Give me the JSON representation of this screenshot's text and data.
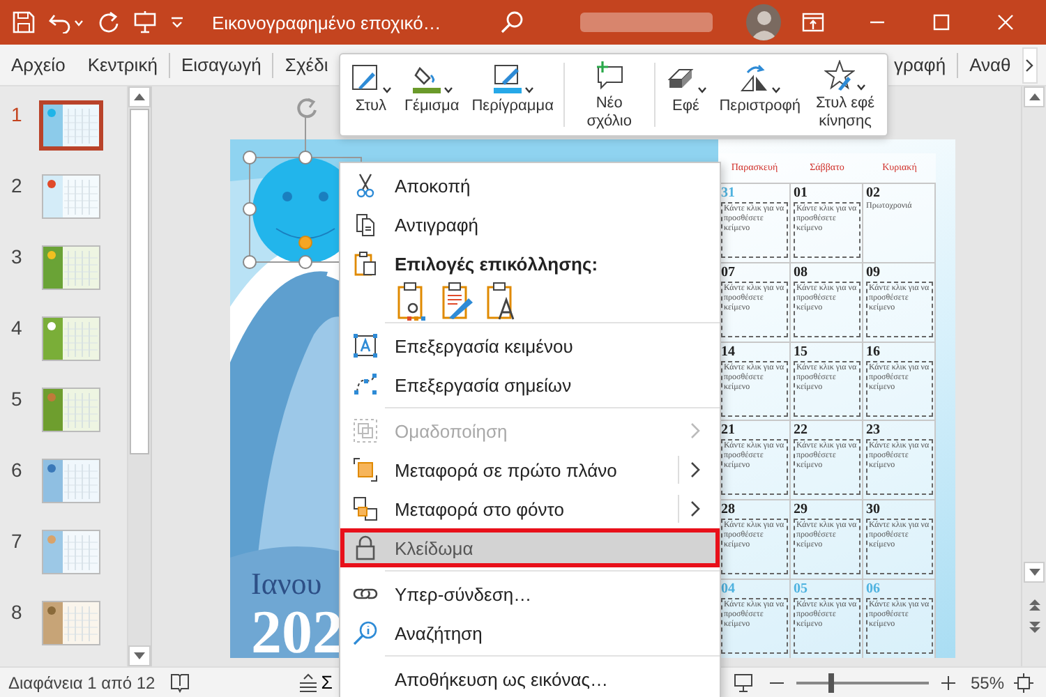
{
  "title_bar": {
    "title": "Εικονογραφημένο εποχικό…"
  },
  "ribbon": {
    "tabs_before_toolbar": [
      {
        "label": "Αρχείο"
      },
      {
        "label": "Κεντρική"
      },
      {
        "label": "Εισαγωγή"
      },
      {
        "label": "Σχέδι"
      }
    ],
    "tabs_after_toolbar": [
      {
        "label": "γραφή"
      },
      {
        "label": "Αναθ"
      }
    ]
  },
  "mini_toolbar": {
    "groups": [
      [
        {
          "label": "Στυλ",
          "dropdown": true
        },
        {
          "label": "Γέμισμα",
          "dropdown": true
        },
        {
          "label": "Περίγραμμα",
          "dropdown": true
        }
      ],
      [
        {
          "label": "Νέο σχόλιο",
          "dropdown": false
        }
      ],
      [
        {
          "label": "Εφέ",
          "dropdown": true
        },
        {
          "label": "Περιστροφή",
          "dropdown": true
        },
        {
          "label": "Στυλ εφέ κίνησης",
          "dropdown": true
        }
      ]
    ]
  },
  "slide_thumbnails": [
    {
      "number": "1",
      "selected": true
    },
    {
      "number": "2",
      "selected": false
    },
    {
      "number": "3",
      "selected": false
    },
    {
      "number": "4",
      "selected": false
    },
    {
      "number": "5",
      "selected": false
    },
    {
      "number": "6",
      "selected": false
    },
    {
      "number": "7",
      "selected": false
    },
    {
      "number": "8",
      "selected": false
    }
  ],
  "slide": {
    "month": "Ιανου",
    "year": "202",
    "calendar": {
      "headers": [
        "Παρασκευή",
        "Σάββατο",
        "Κυριακή"
      ],
      "rows": [
        [
          {
            "day": "31",
            "muted": true,
            "kind": "placeholder",
            "note": "Κάντε κλικ για να προσθέσετε κείμενο"
          },
          {
            "day": "01",
            "muted": false,
            "kind": "placeholder",
            "note": "Κάντε κλικ για να προσθέσετε κείμενο"
          },
          {
            "day": "02",
            "muted": false,
            "kind": "event",
            "note": "Πρωτοχρονιά"
          }
        ],
        [
          {
            "day": "07",
            "muted": false,
            "kind": "placeholder",
            "note": "Κάντε κλικ για να προσθέσετε κείμενο"
          },
          {
            "day": "08",
            "muted": false,
            "kind": "placeholder",
            "note": "Κάντε κλικ για να προσθέσετε κείμενο"
          },
          {
            "day": "09",
            "muted": false,
            "kind": "placeholder",
            "note": "Κάντε κλικ για να προσθέσετε κείμενο"
          }
        ],
        [
          {
            "day": "14",
            "muted": false,
            "kind": "placeholder",
            "note": "Κάντε κλικ για να προσθέσετε κείμενο"
          },
          {
            "day": "15",
            "muted": false,
            "kind": "placeholder",
            "note": "Κάντε κλικ για να προσθέσετε κείμενο"
          },
          {
            "day": "16",
            "muted": false,
            "kind": "placeholder",
            "note": "Κάντε κλικ για να προσθέσετε κείμενο"
          }
        ],
        [
          {
            "day": "21",
            "muted": false,
            "kind": "placeholder",
            "note": "Κάντε κλικ για να προσθέσετε κείμενο"
          },
          {
            "day": "22",
            "muted": false,
            "kind": "placeholder",
            "note": "Κάντε κλικ για να προσθέσετε κείμενο"
          },
          {
            "day": "23",
            "muted": false,
            "kind": "placeholder",
            "note": "Κάντε κλικ για να προσθέσετε κείμενο"
          }
        ],
        [
          {
            "day": "28",
            "muted": false,
            "kind": "placeholder",
            "note": "Κάντε κλικ για να προσθέσετε κείμενο"
          },
          {
            "day": "29",
            "muted": false,
            "kind": "placeholder",
            "note": "Κάντε κλικ για να προσθέσετε κείμενο"
          },
          {
            "day": "30",
            "muted": false,
            "kind": "placeholder",
            "note": "Κάντε κλικ για να προσθέσετε κείμενο"
          }
        ],
        [
          {
            "day": "04",
            "muted": true,
            "kind": "placeholder",
            "note": "Κάντε κλικ για να προσθέσετε κείμενο"
          },
          {
            "day": "05",
            "muted": true,
            "kind": "placeholder",
            "note": "Κάντε κλικ για να προσθέσετε κείμενο"
          },
          {
            "day": "06",
            "muted": true,
            "kind": "placeholder",
            "note": "Κάντε κλικ για να προσθέσετε κείμενο"
          }
        ]
      ]
    }
  },
  "context_menu": {
    "sections": [
      [
        {
          "kind": "command",
          "label": "Αποκοπή",
          "disabled": false,
          "submenu": false,
          "highlighted": false
        },
        {
          "kind": "command",
          "label": "Αντιγραφή",
          "disabled": false,
          "submenu": false,
          "highlighted": false
        },
        {
          "kind": "heading",
          "label": "Επιλογές επικόλλησης:"
        },
        {
          "kind": "paste_options"
        }
      ],
      [
        {
          "kind": "command",
          "label": "Επεξεργασία κειμένου",
          "disabled": false,
          "submenu": false,
          "highlighted": false
        },
        {
          "kind": "command",
          "label": "Επεξεργασία σημείων",
          "disabled": false,
          "submenu": false,
          "highlighted": false
        }
      ],
      [
        {
          "kind": "command",
          "label": "Ομαδοποίηση",
          "disabled": true,
          "submenu": true,
          "highlighted": false
        },
        {
          "kind": "command",
          "label": "Μεταφορά σε πρώτο πλάνο",
          "disabled": false,
          "submenu": true,
          "highlighted": false
        },
        {
          "kind": "command",
          "label": "Μεταφορά στο φόντο",
          "disabled": false,
          "submenu": true,
          "highlighted": false
        },
        {
          "kind": "command",
          "label": "Κλείδωμα",
          "disabled": false,
          "submenu": false,
          "highlighted": true
        }
      ],
      [
        {
          "kind": "command",
          "label": "Υπερ-σύνδεση…",
          "disabled": false,
          "submenu": false,
          "highlighted": false
        },
        {
          "kind": "command",
          "label": "Αναζήτηση",
          "disabled": false,
          "submenu": false,
          "highlighted": false
        }
      ],
      [
        {
          "kind": "command",
          "label": "Αποθήκευση ως εικόνας…",
          "disabled": false,
          "submenu": false,
          "highlighted": false
        }
      ]
    ]
  },
  "status_bar": {
    "slide_info": "Διαφάνεια 1 από 12",
    "view_label": "Σ",
    "zoom": {
      "level": 0.26,
      "reading": "55%"
    }
  }
}
